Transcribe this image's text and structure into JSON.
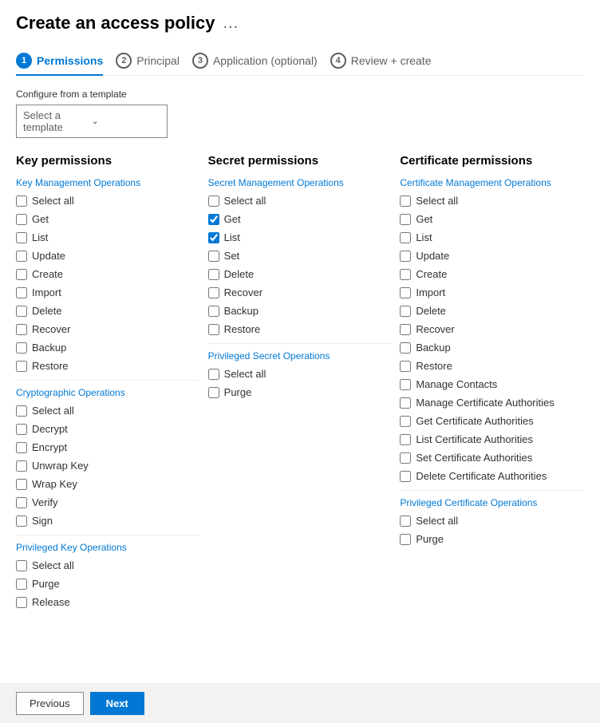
{
  "page": {
    "title": "Create an access policy",
    "title_dots": "..."
  },
  "wizard": {
    "tabs": [
      {
        "id": "permissions",
        "number": "1",
        "label": "Permissions",
        "active": true
      },
      {
        "id": "principal",
        "number": "2",
        "label": "Principal",
        "active": false
      },
      {
        "id": "application",
        "number": "3",
        "label": "Application (optional)",
        "active": false
      },
      {
        "id": "review",
        "number": "4",
        "label": "Review + create",
        "active": false
      }
    ]
  },
  "configure": {
    "label": "Configure from a template",
    "dropdown_placeholder": "Select a template"
  },
  "key_permissions": {
    "section_title": "Key permissions",
    "groups": [
      {
        "title": "Key Management Operations",
        "items": [
          {
            "id": "km_selectall",
            "label": "Select all",
            "checked": false
          },
          {
            "id": "km_get",
            "label": "Get",
            "checked": false
          },
          {
            "id": "km_list",
            "label": "List",
            "checked": false
          },
          {
            "id": "km_update",
            "label": "Update",
            "checked": false
          },
          {
            "id": "km_create",
            "label": "Create",
            "checked": false
          },
          {
            "id": "km_import",
            "label": "Import",
            "checked": false
          },
          {
            "id": "km_delete",
            "label": "Delete",
            "checked": false
          },
          {
            "id": "km_recover",
            "label": "Recover",
            "checked": false
          },
          {
            "id": "km_backup",
            "label": "Backup",
            "checked": false
          },
          {
            "id": "km_restore",
            "label": "Restore",
            "checked": false
          }
        ]
      },
      {
        "title": "Cryptographic Operations",
        "items": [
          {
            "id": "co_selectall",
            "label": "Select all",
            "checked": false
          },
          {
            "id": "co_decrypt",
            "label": "Decrypt",
            "checked": false
          },
          {
            "id": "co_encrypt",
            "label": "Encrypt",
            "checked": false
          },
          {
            "id": "co_unwrapkey",
            "label": "Unwrap Key",
            "checked": false
          },
          {
            "id": "co_wrapkey",
            "label": "Wrap Key",
            "checked": false
          },
          {
            "id": "co_verify",
            "label": "Verify",
            "checked": false
          },
          {
            "id": "co_sign",
            "label": "Sign",
            "checked": false
          }
        ]
      },
      {
        "title": "Privileged Key Operations",
        "items": [
          {
            "id": "pk_selectall",
            "label": "Select all",
            "checked": false
          },
          {
            "id": "pk_purge",
            "label": "Purge",
            "checked": false
          },
          {
            "id": "pk_release",
            "label": "Release",
            "checked": false
          }
        ]
      }
    ]
  },
  "secret_permissions": {
    "section_title": "Secret permissions",
    "groups": [
      {
        "title": "Secret Management Operations",
        "items": [
          {
            "id": "sm_selectall",
            "label": "Select all",
            "checked": false
          },
          {
            "id": "sm_get",
            "label": "Get",
            "checked": true
          },
          {
            "id": "sm_list",
            "label": "List",
            "checked": true
          },
          {
            "id": "sm_set",
            "label": "Set",
            "checked": false
          },
          {
            "id": "sm_delete",
            "label": "Delete",
            "checked": false
          },
          {
            "id": "sm_recover",
            "label": "Recover",
            "checked": false
          },
          {
            "id": "sm_backup",
            "label": "Backup",
            "checked": false
          },
          {
            "id": "sm_restore",
            "label": "Restore",
            "checked": false
          }
        ]
      },
      {
        "title": "Privileged Secret Operations",
        "items": [
          {
            "id": "ps_selectall",
            "label": "Select all",
            "checked": false
          },
          {
            "id": "ps_purge",
            "label": "Purge",
            "checked": false
          }
        ]
      }
    ]
  },
  "certificate_permissions": {
    "section_title": "Certificate permissions",
    "groups": [
      {
        "title": "Certificate Management Operations",
        "items": [
          {
            "id": "cert_selectall",
            "label": "Select all",
            "checked": false
          },
          {
            "id": "cert_get",
            "label": "Get",
            "checked": false
          },
          {
            "id": "cert_list",
            "label": "List",
            "checked": false
          },
          {
            "id": "cert_update",
            "label": "Update",
            "checked": false
          },
          {
            "id": "cert_create",
            "label": "Create",
            "checked": false
          },
          {
            "id": "cert_import",
            "label": "Import",
            "checked": false
          },
          {
            "id": "cert_delete",
            "label": "Delete",
            "checked": false
          },
          {
            "id": "cert_recover",
            "label": "Recover",
            "checked": false
          },
          {
            "id": "cert_backup",
            "label": "Backup",
            "checked": false
          },
          {
            "id": "cert_restore",
            "label": "Restore",
            "checked": false
          },
          {
            "id": "cert_managecontacts",
            "label": "Manage Contacts",
            "checked": false
          },
          {
            "id": "cert_managecas",
            "label": "Manage Certificate Authorities",
            "checked": false
          },
          {
            "id": "cert_getcas",
            "label": "Get Certificate Authorities",
            "checked": false
          },
          {
            "id": "cert_listcas",
            "label": "List Certificate Authorities",
            "checked": false
          },
          {
            "id": "cert_setcas",
            "label": "Set Certificate Authorities",
            "checked": false
          },
          {
            "id": "cert_deletecas",
            "label": "Delete Certificate Authorities",
            "checked": false
          }
        ]
      },
      {
        "title": "Privileged Certificate Operations",
        "items": [
          {
            "id": "pc_selectall",
            "label": "Select all",
            "checked": false
          },
          {
            "id": "pc_purge",
            "label": "Purge",
            "checked": false
          }
        ]
      }
    ]
  },
  "footer": {
    "previous_label": "Previous",
    "next_label": "Next"
  }
}
